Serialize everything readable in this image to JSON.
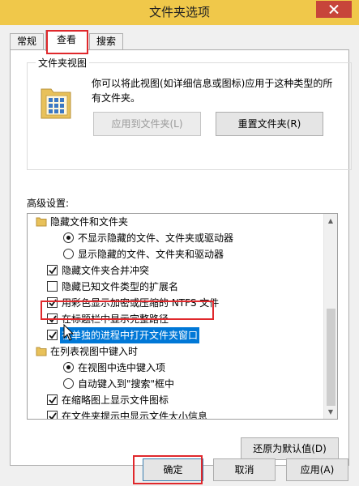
{
  "window": {
    "title": "文件夹选项",
    "close_icon": "close-icon"
  },
  "tabs": [
    {
      "label": "常规",
      "active": false
    },
    {
      "label": "查看",
      "active": true
    },
    {
      "label": "搜索",
      "active": false
    }
  ],
  "folder_views": {
    "title": "文件夹视图",
    "description": "你可以将此视图(如详细信息或图标)应用于这种类型的所有文件夹。",
    "icon": "folder-view-icon",
    "apply_button": "应用到文件夹(L)",
    "reset_button": "重置文件夹(R)"
  },
  "advanced": {
    "label": "高级设置:",
    "items": [
      {
        "kind": "folder",
        "text": "隐藏文件和文件夹"
      },
      {
        "kind": "radio",
        "checked": true,
        "text": "不显示隐藏的文件、文件夹或驱动器"
      },
      {
        "kind": "radio",
        "checked": false,
        "text": "显示隐藏的文件、文件夹和驱动器"
      },
      {
        "kind": "checkbox",
        "checked": true,
        "text": "隐藏文件夹合并冲突"
      },
      {
        "kind": "checkbox",
        "checked": false,
        "text": "隐藏已知文件类型的扩展名"
      },
      {
        "kind": "checkbox",
        "checked": true,
        "text": "用彩色显示加密或压缩的 NTFS 文件"
      },
      {
        "kind": "checkbox",
        "checked": true,
        "text": "在标题栏中显示完整路径"
      },
      {
        "kind": "checkbox",
        "checked": true,
        "text": "在单独的进程中打开文件夹窗口",
        "selected": true
      },
      {
        "kind": "folder",
        "text": "在列表视图中键入时"
      },
      {
        "kind": "radio",
        "checked": true,
        "text": "在视图中选中键入项"
      },
      {
        "kind": "radio",
        "checked": false,
        "text": "自动键入到\"搜索\"框中"
      },
      {
        "kind": "checkbox",
        "checked": true,
        "text": "在缩略图上显示文件图标"
      },
      {
        "kind": "checkbox",
        "checked": true,
        "text": "在文件夹提示中显示文件大小信息"
      }
    ]
  },
  "restore_defaults_button": "还原为默认值(D)",
  "footer": {
    "ok": "确定",
    "cancel": "取消",
    "apply": "应用(A)"
  },
  "colors": {
    "title_bar": "#f0c84a",
    "close_button": "#c7453a",
    "highlight_box": "#e0282c",
    "selection": "#0078d7"
  }
}
